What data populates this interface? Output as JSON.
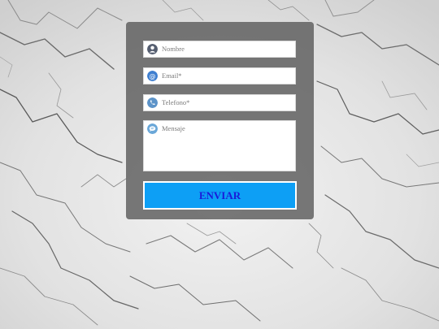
{
  "form": {
    "name": {
      "placeholder": "Nombre",
      "icon": "user-icon"
    },
    "email": {
      "placeholder": "Email*",
      "icon": "at-icon"
    },
    "phone": {
      "placeholder": "Telefono*",
      "icon": "phone-icon"
    },
    "message": {
      "placeholder": "Mensaje",
      "icon": "chat-bubble-icon"
    },
    "submit_label": "ENVIAR"
  },
  "colors": {
    "panel": "#5c5c5c",
    "button": "#0d9ff5",
    "button_text": "#1a1ad9",
    "icon_dark": "#555e70",
    "icon_blue": "#3f7fd0"
  }
}
